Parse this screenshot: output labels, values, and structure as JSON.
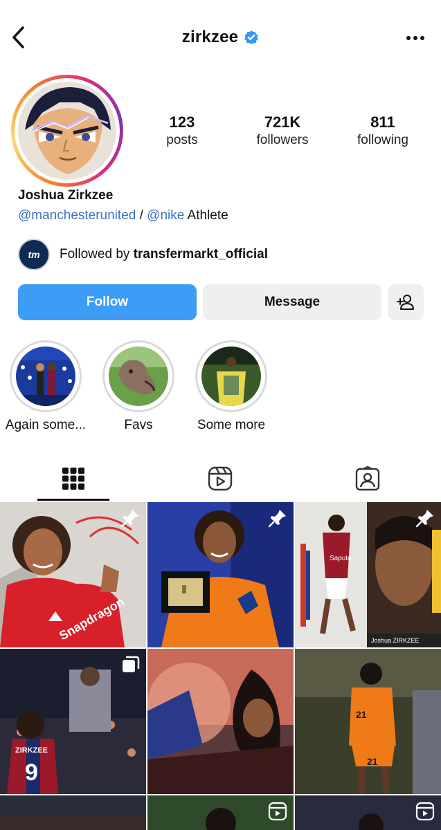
{
  "header": {
    "title": "zirkzee",
    "verified": true,
    "back_icon": "chevron-left-icon",
    "more_icon": "more-horizontal-icon"
  },
  "profile": {
    "name": "Joshua Zirkzee",
    "bio": {
      "link1": "@manchesterunited",
      "separator": " / ",
      "link2": "@nike",
      "suffix": " Athlete"
    },
    "stats": [
      {
        "value": "123",
        "label": "posts"
      },
      {
        "value": "721K",
        "label": "followers"
      },
      {
        "value": "811",
        "label": "following"
      }
    ],
    "followed_by": {
      "prefix": "Followed by ",
      "account": "transfermarkt_official",
      "logo_text": "tm"
    }
  },
  "actions": {
    "follow": "Follow",
    "message": "Message",
    "add_user_icon": "add-person-icon"
  },
  "highlights": [
    {
      "label": "Again some..."
    },
    {
      "label": "Favs"
    },
    {
      "label": "Some more"
    }
  ],
  "tabs": [
    {
      "icon": "grid-icon",
      "active": true
    },
    {
      "icon": "reels-icon",
      "active": false
    },
    {
      "icon": "tagged-icon",
      "active": false
    }
  ],
  "grid": {
    "posts": [
      {
        "pinned": true,
        "image_caption": "Joshua Zirkzee in red Manchester United kit, thumbs up"
      },
      {
        "pinned": true,
        "image_caption": "Zirkzee in orange Netherlands kit holding award box"
      },
      {
        "pinned": true,
        "image_caption": "Bologna season graphic - Joshua ZIRKZEE BEST"
      },
      {
        "multi": true,
        "image_caption": "Zirkzee number 9 with fans"
      },
      {
        "image_caption": "Celebration with flares"
      },
      {
        "image_caption": "Zirkzee number 21 Netherlands"
      },
      {
        "reel": false,
        "image_caption": ""
      },
      {
        "reel": true,
        "image_caption": ""
      },
      {
        "reel": true,
        "image_caption": ""
      }
    ]
  },
  "colors": {
    "accent": "#3d9cf5",
    "link": "#3b72c9",
    "verified": "#3897f0"
  }
}
